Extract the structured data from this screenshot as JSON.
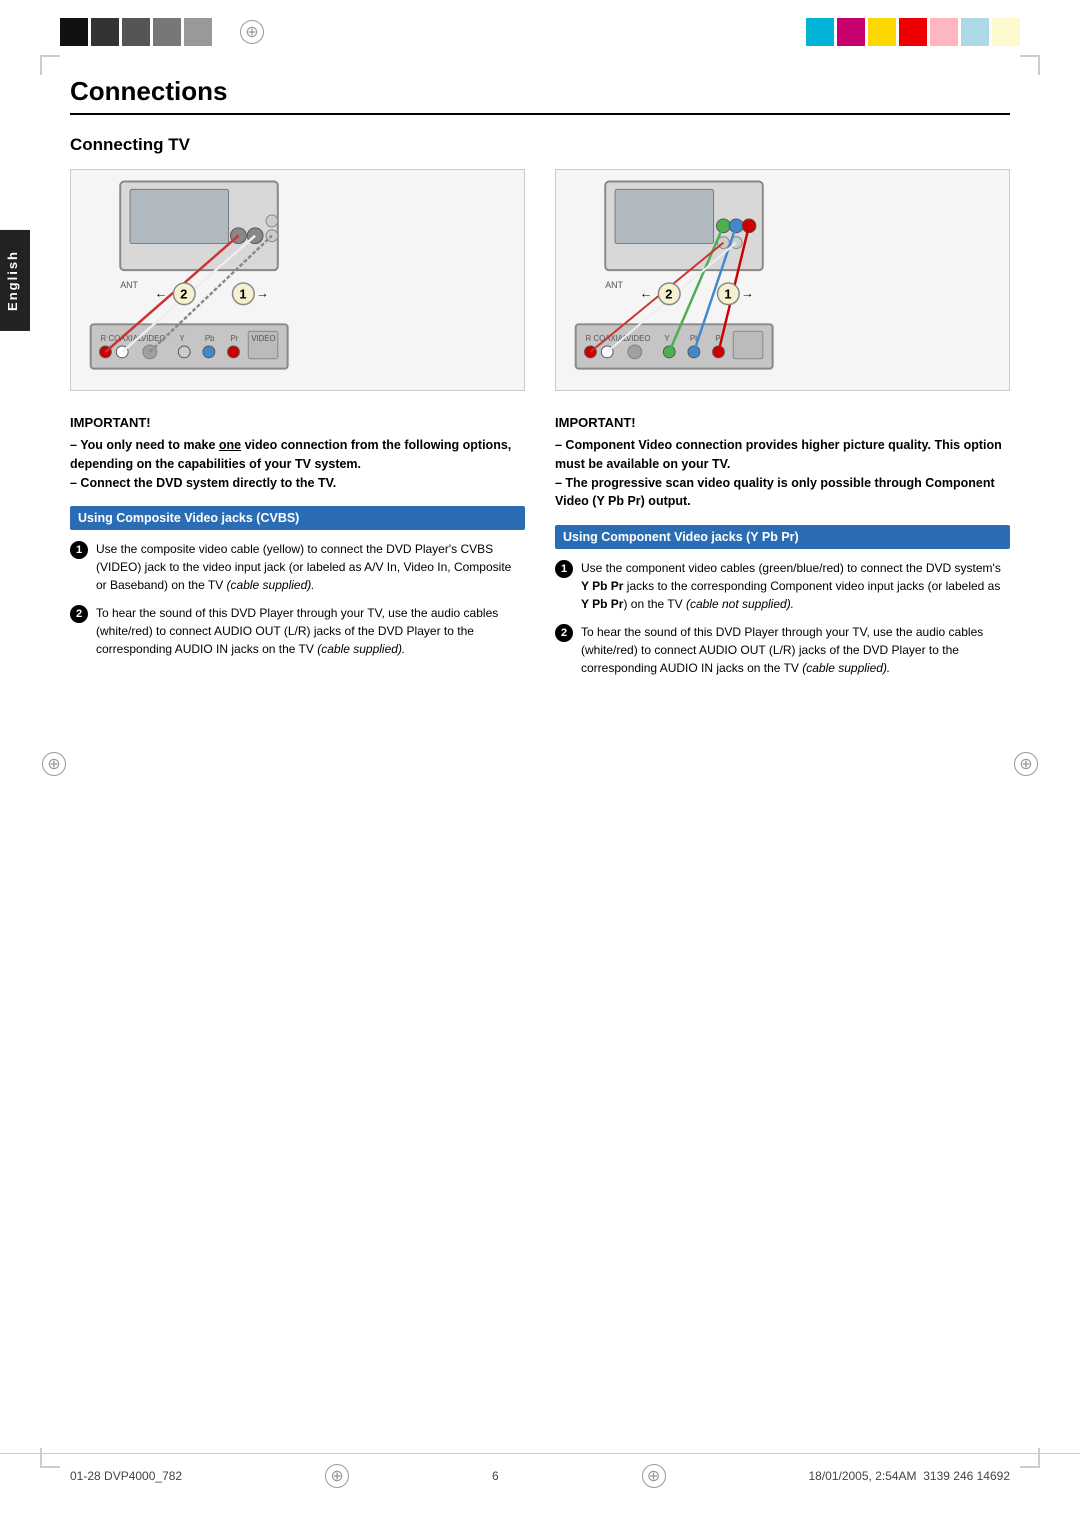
{
  "page": {
    "title": "Connections",
    "subtitle": "Connecting TV",
    "language_label": "English",
    "page_number": "6"
  },
  "footer": {
    "left": "01-28 DVP4000_782",
    "center": "6",
    "right": "18/01/2005, 2:54AM",
    "barcode": "3139 246 14692"
  },
  "important_left": {
    "title": "IMPORTANT!",
    "lines": [
      "– You only need to make one video",
      "connection from the following",
      "options, depending on the",
      "capabilities of your TV system.",
      "– Connect the DVD system directly",
      "to the TV."
    ]
  },
  "important_right": {
    "title": "IMPORTANT!",
    "lines": [
      "– Component Video connection",
      "provides higher picture quality. This",
      "option must be available on your TV.",
      "– The progressive scan video",
      "quality is only possible through",
      "Component Video (Y Pb Pr) output."
    ]
  },
  "section_left": {
    "header": "Using Composite Video jacks (CVBS)",
    "item1": "Use the composite video cable (yellow) to connect the DVD Player's CVBS (VIDEO) jack to the video input jack (or labeled as A/V In, Video In, Composite or Baseband) on the TV",
    "item1_italic": "(cable supplied).",
    "item2": "To hear the sound of this DVD Player through your TV, use the audio cables (white/red) to connect AUDIO OUT (L/R) jacks of the DVD Player to the corresponding AUDIO IN jacks on the TV",
    "item2_italic": "(cable supplied)."
  },
  "section_right": {
    "header": "Using Component Video jacks (Y Pb Pr)",
    "item1": "Use the component video cables (green/blue/red) to connect the DVD system's Y Pb Pr jacks to the corresponding Component video input jacks (or labeled as",
    "item1_bold": "Y Pb Pr",
    "item1b": ") on the TV",
    "item1_italic": "(cable not supplied).",
    "item2": "To hear the sound of this DVD Player through your TV, use the audio cables (white/red) to connect AUDIO OUT (L/R) jacks of the DVD Player to the corresponding AUDIO IN jacks on the TV",
    "item2_italic": "(cable supplied)."
  },
  "colors": {
    "black_swatches": [
      "#111",
      "#333",
      "#555",
      "#777",
      "#999"
    ],
    "color_swatches": [
      "#00b4d8",
      "#c0006e",
      "#ffd700",
      "#cc0000",
      "#ffb6c1",
      "#add8e6",
      "#fffacd"
    ],
    "section_header_bg": "#2a6db5"
  }
}
